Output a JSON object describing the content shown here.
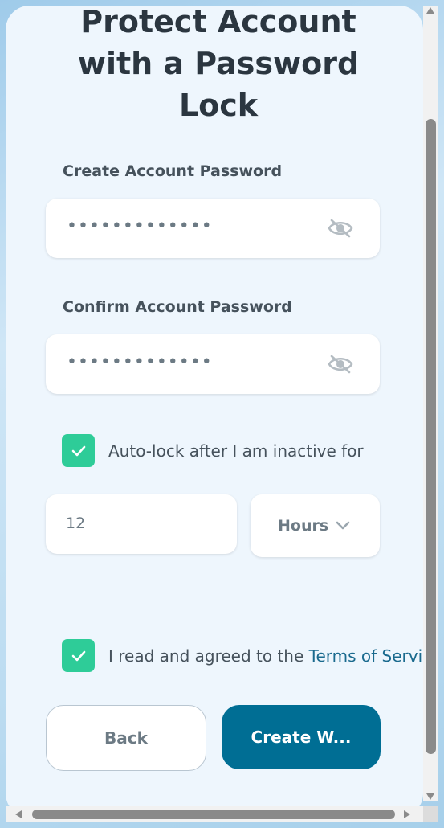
{
  "title_lines": [
    "Protect Account",
    "with a Password",
    "Lock"
  ],
  "password": {
    "label": "Create Account Password",
    "value": "•••••••••••••",
    "icon": "eye-off-icon"
  },
  "confirm": {
    "label": "Confirm Account Password",
    "value": "•••••••••••••",
    "icon": "eye-off-icon"
  },
  "autolock": {
    "checked": true,
    "label": "Auto-lock after I am inactive for",
    "amount": "12",
    "unit": "Hours"
  },
  "terms": {
    "checked": true,
    "prefix": "I read and agreed to the ",
    "link": "Terms of Services"
  },
  "buttons": {
    "back": "Back",
    "create": "Create W..."
  },
  "colors": {
    "accent": "#2ecc98",
    "primary": "#006e94",
    "link": "#1a6a8e"
  }
}
